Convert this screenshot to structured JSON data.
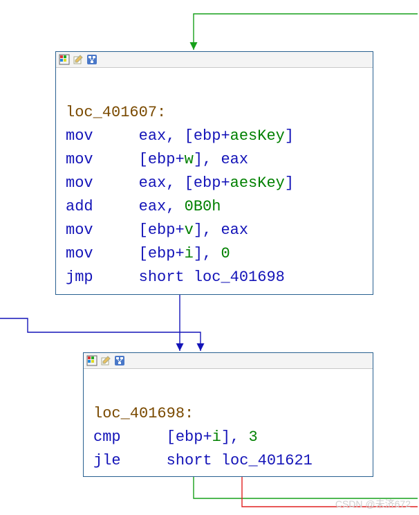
{
  "watermark": "CSDN @未济672",
  "icons": {
    "colorpicker": "color-picker-icon",
    "edit": "edit-icon",
    "graph": "graph-icon"
  },
  "block1": {
    "label": "loc_401607:",
    "lines": [
      {
        "m": "mov",
        "a1": "eax",
        "mem": {
          "base": "ebp",
          "off": "aesKey"
        }
      },
      {
        "m": "mov",
        "memdst": {
          "base": "ebp",
          "off": "w"
        },
        "a2": "eax"
      },
      {
        "m": "mov",
        "a1": "eax",
        "mem": {
          "base": "ebp",
          "off": "aesKey"
        }
      },
      {
        "m": "add",
        "a1": "eax",
        "imm": "0B0h"
      },
      {
        "m": "mov",
        "memdst": {
          "base": "ebp",
          "off": "v"
        },
        "a2": "eax"
      },
      {
        "m": "mov",
        "memdst": {
          "base": "ebp",
          "off": "i"
        },
        "imm": "0"
      },
      {
        "m": "jmp",
        "kw": "short",
        "tgt": "loc_401698"
      }
    ]
  },
  "block2": {
    "label": "loc_401698:",
    "lines": [
      {
        "m": "cmp",
        "memdst": {
          "base": "ebp",
          "off": "i"
        },
        "imm": "3"
      },
      {
        "m": "jle",
        "kw": "short",
        "tgt": "loc_401621"
      }
    ]
  },
  "colors": {
    "border": "#286090",
    "label": "#7a4a00",
    "keyword": "#1414b8",
    "variable": "#008000",
    "arrow_green": "#17a01a",
    "arrow_blue": "#1414b8",
    "arrow_red": "#e02020"
  }
}
